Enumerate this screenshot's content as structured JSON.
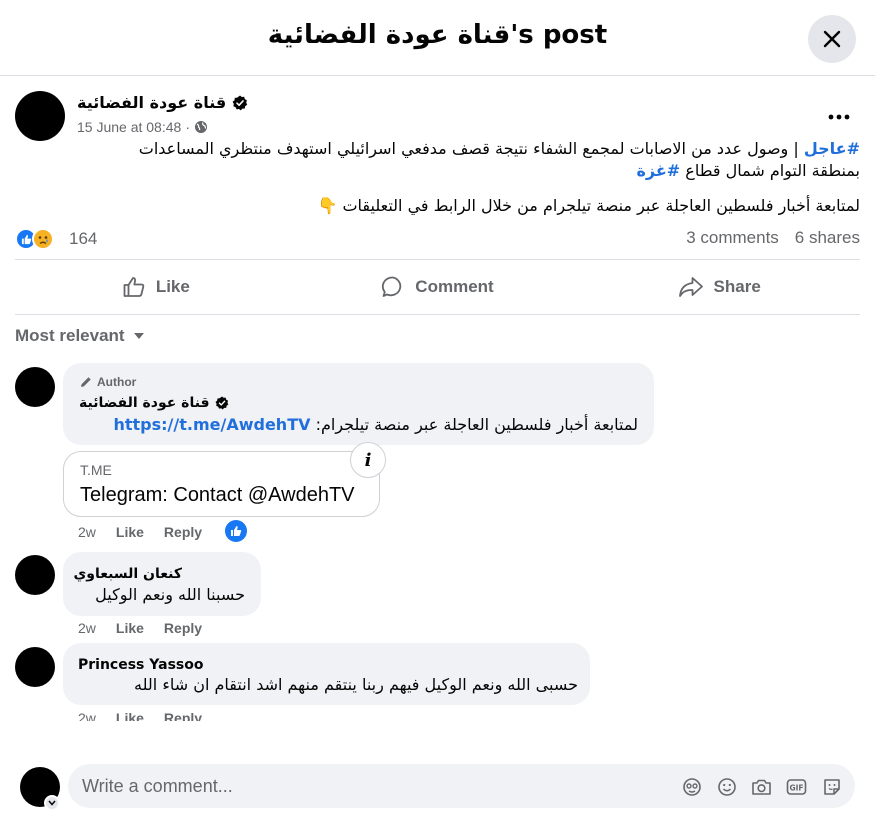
{
  "header": {
    "title": "قناة عودة الفضائية's post"
  },
  "post": {
    "author": "قناة عودة الفضائية",
    "timestamp": "15 June at 08:48",
    "separator": "·",
    "hashtag1": "#عاجل",
    "body_line1": " | وصول عدد من الاصابات لمجمع الشفاء نتيجة قصف مدفعي اسرائيلي استهدف منتظري المساعدات",
    "body_line2": "بمنطقة التوام شمال قطاع ",
    "hashtag2": "#غزة",
    "body_line3": "لمتابعة أخبار فلسطين العاجلة عبر منصة تيلجرام من خلال الرابط في التعليقات 👇",
    "reaction_count": "164",
    "comments_count": "3 comments",
    "shares_count": "6 shares"
  },
  "actions": {
    "like": "Like",
    "comment": "Comment",
    "share": "Share"
  },
  "sort_label": "Most relevant",
  "comments": [
    {
      "badge": "Author",
      "author": "قناة عودة الفضائية",
      "text": "لمتابعة أخبار فلسطين العاجلة عبر منصة تيلجرام: ",
      "link": "https://t.me/AwdehTV",
      "card_domain": "T.ME",
      "card_title": "Telegram: Contact @AwdehTV",
      "time": "2w",
      "like": "Like",
      "reply": "Reply"
    },
    {
      "author": "كنعان السبعاوي",
      "text": "حسبنا الله ونعم الوكيل",
      "time": "2w",
      "like": "Like",
      "reply": "Reply"
    },
    {
      "author": "Princess Yassoo",
      "text": "حسبى الله ونعم الوكيل فيهم ربنا ينتقم منهم اشد انتقام ان شاء الله",
      "time": "2w",
      "like": "Like",
      "reply": "Reply"
    }
  ],
  "composer": {
    "placeholder": "Write a comment..."
  },
  "colors": {
    "link": "#216fdb",
    "like_blue": "#1877f2",
    "muted": "#65676b",
    "bubble": "#f0f2f5"
  }
}
